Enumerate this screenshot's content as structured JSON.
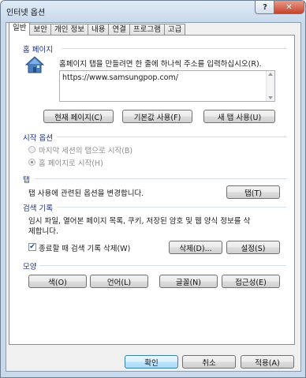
{
  "window": {
    "title": "인터넷 옵션",
    "help": "?",
    "close": "✕"
  },
  "tabs": [
    "일반",
    "보안",
    "개인 정보",
    "내용",
    "연결",
    "프로그램",
    "고급"
  ],
  "home": {
    "group": "홈 페이지",
    "instruction": "홈페이지 탭을 만들려면 한 줄에 하나씩 주소를 입력하십시오(R).",
    "url": "https://www.samsungpop.com/",
    "btn_current": "현재 페이지(C)",
    "btn_default": "기본값 사용(F)",
    "btn_newtab": "새 탭 사용(U)"
  },
  "startup": {
    "group": "시작 옵션",
    "option1": "마지막 세션의 탭으로 시작(B)",
    "option2": "홈 페이지로 시작(H)"
  },
  "tabs_section": {
    "group": "탭",
    "desc": "탭 사용에 관련된 옵션을 변경합니다.",
    "btn": "탭(T)"
  },
  "history": {
    "group": "검색 기록",
    "desc1": "임시 파일, 열어본 페이지 목록, 쿠키, 저장된 암호 및 웹 양식 정보를 삭",
    "desc2": "제합니다.",
    "checkbox": "종료할 때 검색 기록 삭제(W)",
    "checked": true,
    "btn_delete": "삭제(D)...",
    "btn_settings": "설정(S)"
  },
  "appearance": {
    "group": "모양",
    "btn_colors": "색(O)",
    "btn_lang": "언어(L)",
    "btn_fonts": "글꼴(N)",
    "btn_access": "접근성(E)"
  },
  "footer": {
    "ok": "확인",
    "cancel": "취소",
    "apply": "적용(A)"
  }
}
